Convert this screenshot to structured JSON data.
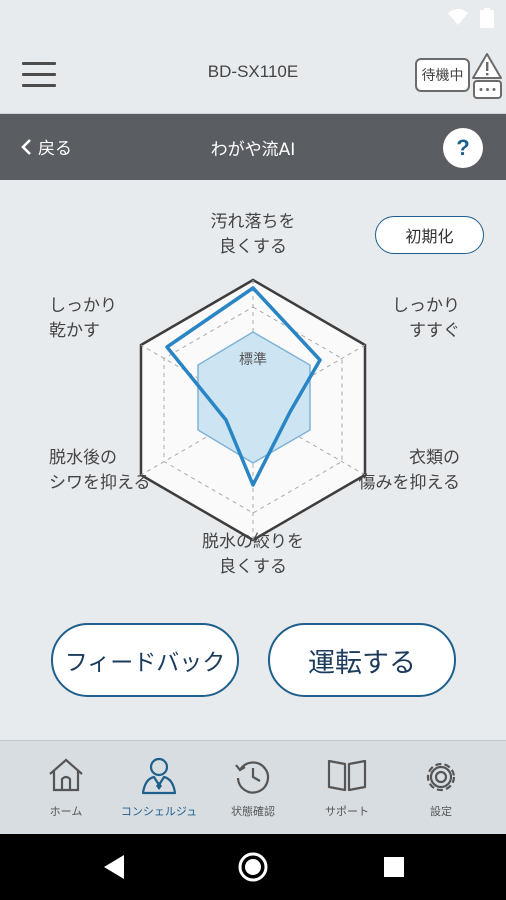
{
  "header": {
    "device_model": "BD-SX110E",
    "standby_label": "待機中"
  },
  "nav": {
    "back_label": "戻る",
    "title": "わがや流AI",
    "help_label": "?"
  },
  "main": {
    "reset_label": "初期化",
    "center_label": "標準",
    "axes": {
      "top": [
        "汚れ落ちを",
        "良くする"
      ],
      "upper_right": [
        "しっかり",
        "すすぐ"
      ],
      "lower_right": [
        "衣類の",
        "傷みを抑える"
      ],
      "bottom": [
        "脱水の絞りを",
        "良くする"
      ],
      "lower_left": [
        "脱水後の",
        "シワを抑える"
      ],
      "upper_left": [
        "しっかり",
        "乾かす"
      ]
    },
    "feedback_label": "フィードバック",
    "run_label": "運転する"
  },
  "tabs": [
    {
      "label": "ホーム",
      "icon": "home-icon",
      "active": false
    },
    {
      "label": "コンシェルジュ",
      "icon": "concierge-icon",
      "active": true
    },
    {
      "label": "状態確認",
      "icon": "status-clock-icon",
      "active": false
    },
    {
      "label": "サポート",
      "icon": "book-icon",
      "active": false
    },
    {
      "label": "設定",
      "icon": "gear-icon",
      "active": false
    }
  ],
  "colors": {
    "accent": "#1e5f8c",
    "radar_line": "#2a85c4",
    "nav_bar": "#5a5e63"
  }
}
